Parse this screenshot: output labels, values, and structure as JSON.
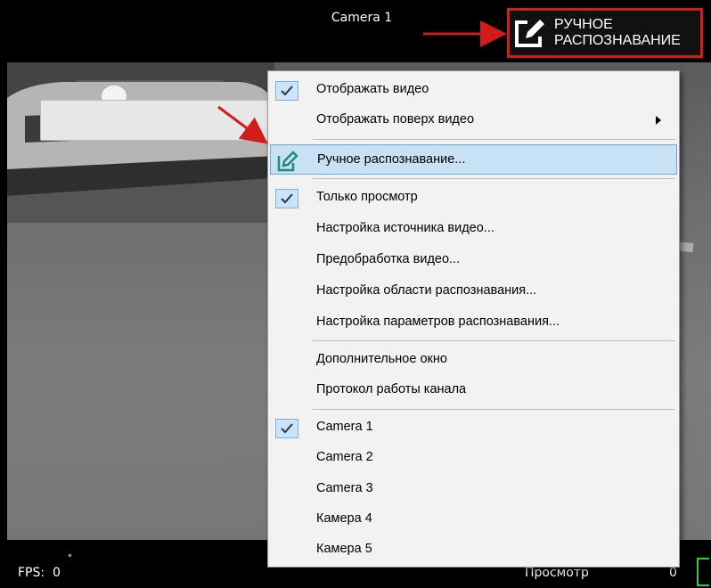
{
  "window": {
    "camera_title": "Camera 1",
    "manual_button_label": "Ручное\nраспознавание",
    "accent_color": "#d21c1c"
  },
  "menu": {
    "items": [
      {
        "label": "Отображать видео",
        "checked": true
      },
      {
        "label": "Отображать поверх видео",
        "submenu": true
      },
      {
        "label": "Ручное распознавание...",
        "icon": "edit-icon",
        "highlighted": true
      },
      {
        "label": "Только просмотр",
        "checked": true
      },
      {
        "label": "Настройка источника видео..."
      },
      {
        "label": "Предобработка видео..."
      },
      {
        "label": "Настройка области распознавания..."
      },
      {
        "label": "Настройка параметров распознавания..."
      },
      {
        "label": "Дополнительное окно"
      },
      {
        "label": "Протокол работы канала"
      },
      {
        "label": "Camera 1",
        "checked": true
      },
      {
        "label": "Camera 2"
      },
      {
        "label": "Camera 3"
      },
      {
        "label": "Камера 4"
      },
      {
        "label": "Камера 5"
      }
    ]
  },
  "status": {
    "fps_label": "FPS:",
    "fps_value": "0",
    "view_label": "Просмотр",
    "count": "0"
  }
}
